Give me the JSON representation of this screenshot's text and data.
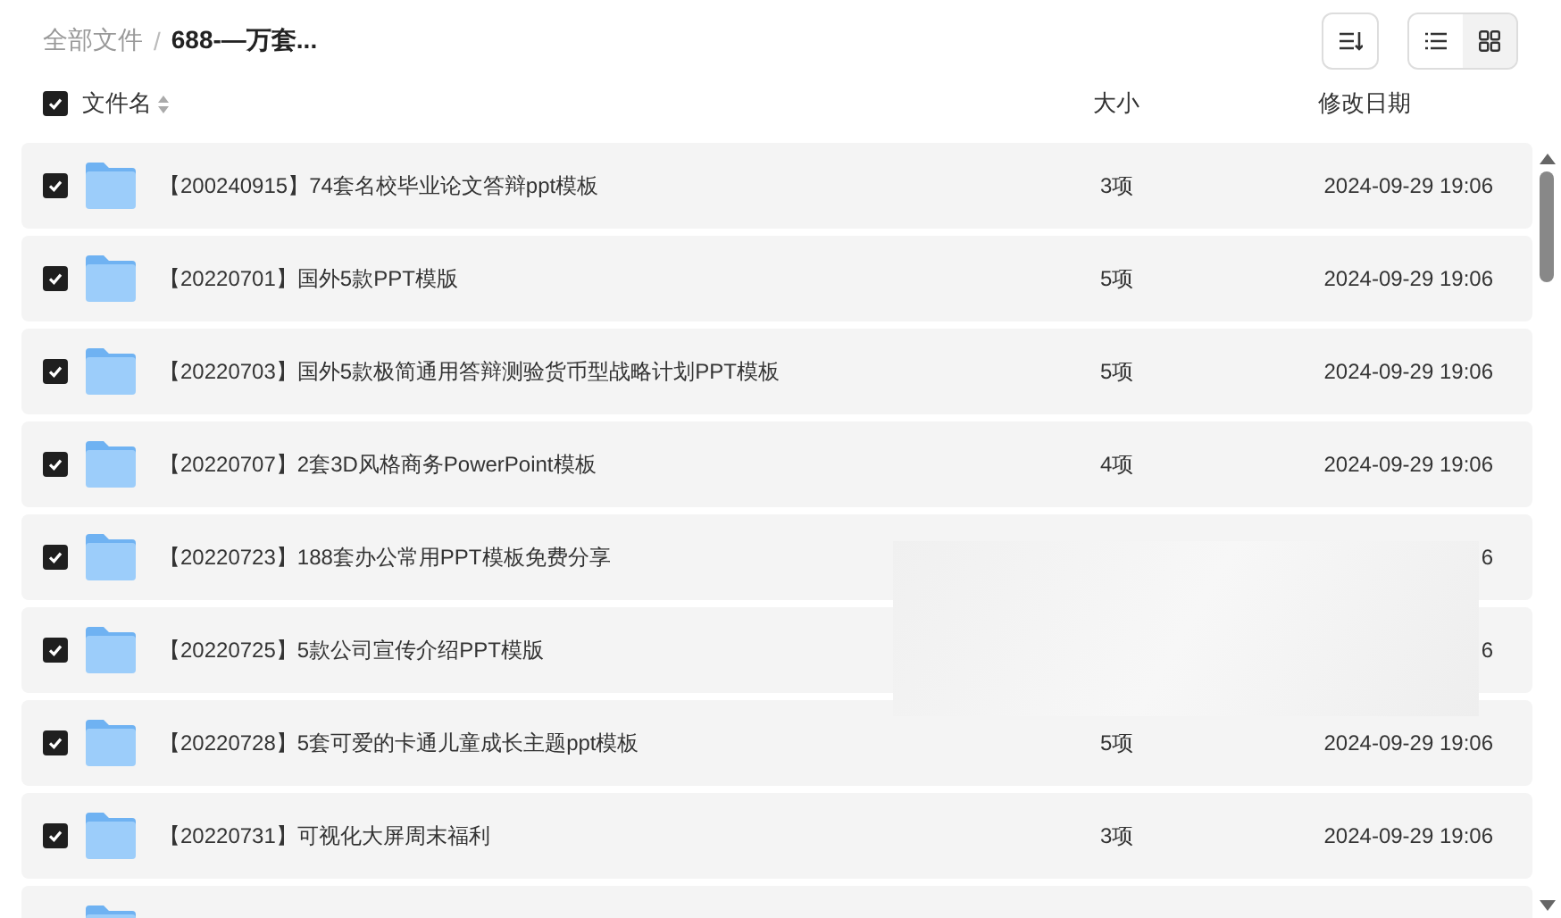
{
  "breadcrumb": [
    {
      "label": "全部文件",
      "selected": false
    },
    {
      "label": "688-—万套...",
      "selected": true
    }
  ],
  "breadcrumb_separator": "/",
  "view_toggle": [
    {
      "kind": "list",
      "selected": true
    },
    {
      "kind": "grid",
      "selected": false
    }
  ],
  "header": {
    "all_checked": true,
    "columns": [
      "文件名",
      "大小",
      "修改日期"
    ]
  },
  "rows": [
    {
      "checked": true,
      "name": "【200240915】74套名校毕业论文答辩ppt模板",
      "size": "3项",
      "date": "2024-09-29 19:06"
    },
    {
      "checked": true,
      "name": "【20220701】国外5款PPT模版",
      "size": "5项",
      "date": "2024-09-29 19:06"
    },
    {
      "checked": true,
      "name": "【20220703】国外5款极简通用答辩测验货币型战略计划PPT模板",
      "size": "5项",
      "date": "2024-09-29 19:06"
    },
    {
      "checked": true,
      "name": "【20220707】2套3D风格商务PowerPoint模板",
      "size": "4项",
      "date": "2024-09-29 19:06"
    },
    {
      "checked": true,
      "name": "【20220723】188套办公常用PPT模板免费分享",
      "date": "6"
    },
    {
      "checked": true,
      "name": "【20220725】5款公司宣传介绍PPT模版",
      "date": "6"
    },
    {
      "checked": true,
      "name": "【20220728】5套可爱的卡通儿童成长主题ppt模板",
      "size": "5项",
      "date": "2024-09-29 19:06"
    },
    {
      "checked": true,
      "name": "【20220731】可视化大屏周末福利",
      "size": "3项",
      "date": "2024-09-29 19:06"
    },
    {}
  ]
}
